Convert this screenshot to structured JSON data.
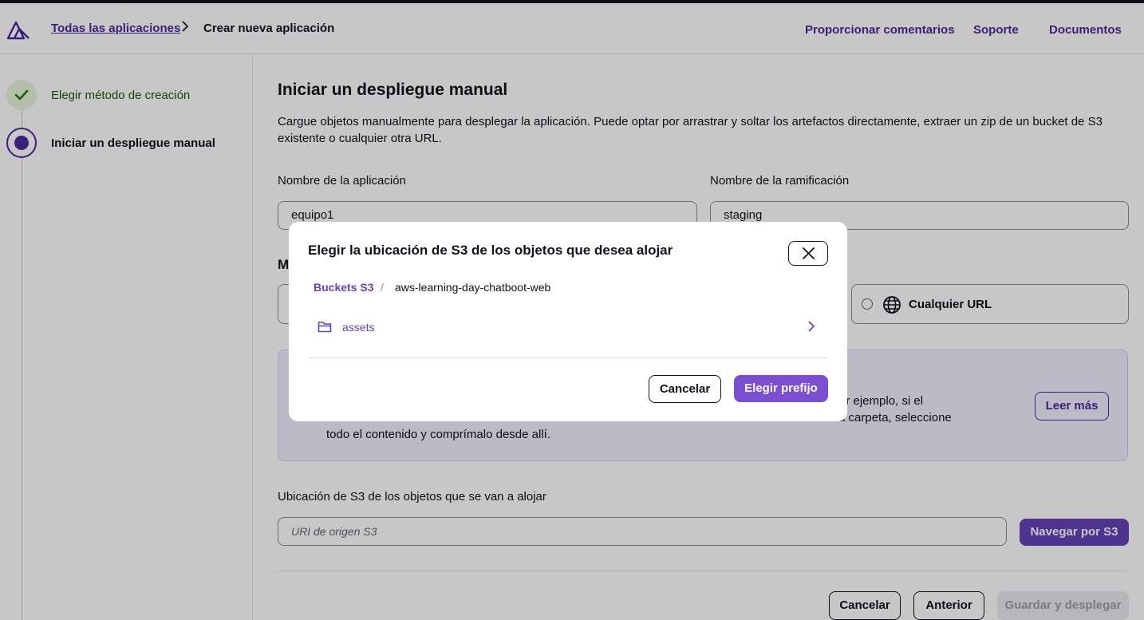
{
  "header": {
    "breadcrumb_link": "Todas las aplicaciones",
    "breadcrumb_current": "Crear nueva aplicación",
    "links": [
      "Proporcionar comentarios",
      "Soporte",
      "Documentos"
    ]
  },
  "sidebar": {
    "steps": [
      {
        "label": "Elegir método de creación",
        "state": "completed"
      },
      {
        "label": "Iniciar un despliegue manual",
        "state": "current"
      }
    ]
  },
  "main": {
    "title": "Iniciar un despliegue manual",
    "description": "Cargue objetos manualmente para desplegar la aplicación. Puede optar por arrastrar y soltar los artefactos directamente, extraer un zip de un bucket de S3 existente o cualquier otra URL.",
    "app_name_label": "Nombre de la aplicación",
    "app_name_value": "equipo1",
    "branch_label": "Nombre de la ramificación",
    "branch_value": "staging",
    "method_heading_partial": "M",
    "any_url_label": "Cualquier URL",
    "info_line1_partial": "or ejemplo, si el",
    "info_line2_partial": "a carpeta, seleccione",
    "info_line3": "todo el contenido y comprímalo desde allí.",
    "read_more": "Leer más",
    "s3_location_label": "Ubicación de S3 de los objetos que se van a alojar",
    "s3_uri_placeholder": "URI de origen S3",
    "browse_s3": "Navegar por S3",
    "cancel": "Cancelar",
    "previous": "Anterior",
    "save_deploy": "Guardar y desplegar"
  },
  "modal": {
    "title": "Elegir la ubicación de S3 de los objetos que desea alojar",
    "crumb_root": "Buckets S3",
    "crumb_sep": "/",
    "crumb_bucket": "aws-learning-day-chatboot-web",
    "folder": "assets",
    "cancel": "Cancelar",
    "choose_prefix": "Elegir prefijo"
  },
  "colors": {
    "brand": "#4a2a9a",
    "primary": "#7b4fd1",
    "success": "#1d8102",
    "info_bg": "#f3efff"
  }
}
